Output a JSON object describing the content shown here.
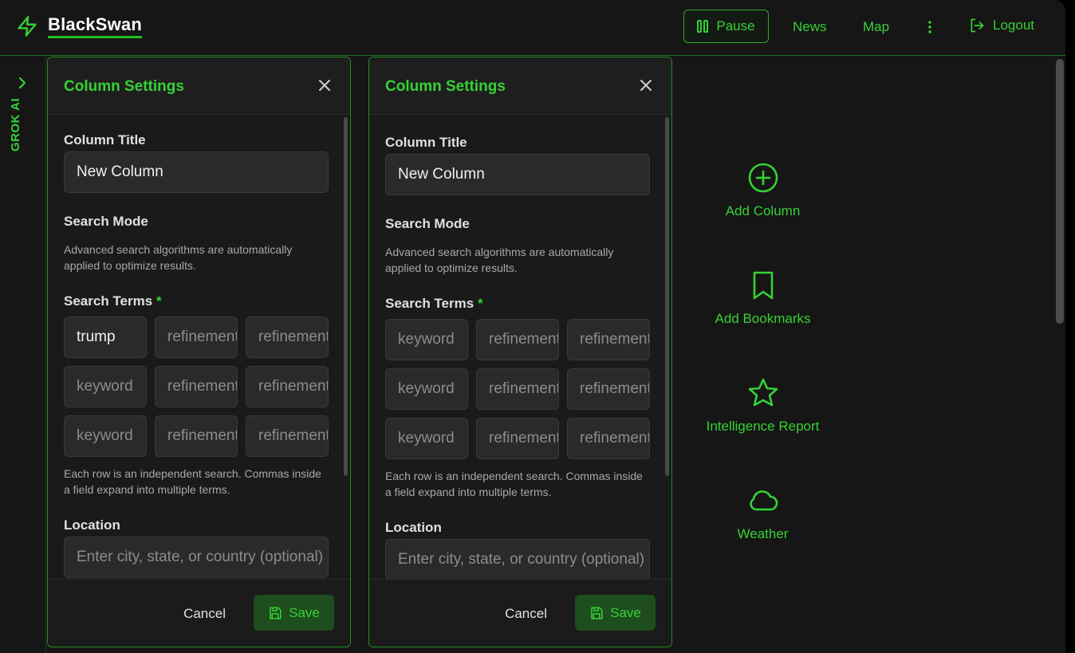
{
  "app": {
    "name": "BlackSwan"
  },
  "header": {
    "pause_label": "Pause",
    "nav": [
      "News",
      "Map"
    ],
    "logout_label": "Logout"
  },
  "sidebar": {
    "grok_label": "GROK AI"
  },
  "panels": [
    {
      "title": "Column Settings",
      "column_title_label": "Column Title",
      "column_title_value": "New Column",
      "search_mode_label": "Search Mode",
      "search_mode_help": "Advanced search algorithms are automatically applied to optimize results.",
      "search_terms_label": "Search Terms",
      "required_mark": "*",
      "terms": [
        {
          "value": "trump",
          "placeholders": [
            "refinement",
            "refinement"
          ]
        },
        {
          "value": "",
          "placeholders": [
            "refinement",
            "refinement"
          ]
        },
        {
          "value": "",
          "placeholders": [
            "refinement",
            "refinement"
          ]
        }
      ],
      "keyword_placeholder": "keyword",
      "terms_help": "Each row is an independent search. Commas inside a field expand into multiple terms.",
      "location_label": "Location",
      "location_placeholder": "Enter city, state, or country (optional)",
      "cancel_label": "Cancel",
      "save_label": "Save"
    },
    {
      "title": "Column Settings",
      "column_title_label": "Column Title",
      "column_title_value": "New Column",
      "search_mode_label": "Search Mode",
      "search_mode_help": "Advanced search algorithms are automatically applied to optimize results.",
      "search_terms_label": "Search Terms",
      "required_mark": "*",
      "terms": [
        {
          "value": "",
          "placeholders": [
            "refinement",
            "refinement"
          ]
        },
        {
          "value": "",
          "placeholders": [
            "refinement",
            "refinement"
          ]
        },
        {
          "value": "",
          "placeholders": [
            "refinement",
            "refinement"
          ]
        }
      ],
      "keyword_placeholder": "keyword",
      "terms_help": "Each row is an independent search. Commas inside a field expand into multiple terms.",
      "location_label": "Location",
      "location_placeholder": "Enter city, state, or country (optional)",
      "cancel_label": "Cancel",
      "save_label": "Save"
    }
  ],
  "actions": [
    {
      "label": "Add Column",
      "icon": "plus-circle-icon"
    },
    {
      "label": "Add Bookmarks",
      "icon": "bookmark-icon"
    },
    {
      "label": "Intelligence Report",
      "icon": "star-icon"
    },
    {
      "label": "Weather",
      "icon": "cloud-icon"
    }
  ],
  "colors": {
    "accent": "#35d235",
    "border": "#1f8f1f",
    "background": "#161616"
  }
}
